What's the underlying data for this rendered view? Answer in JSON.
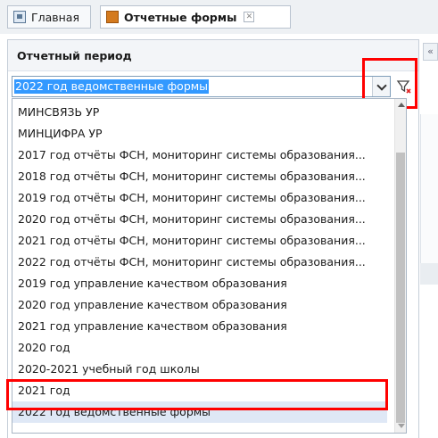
{
  "tabs": [
    {
      "label": "Главная",
      "icon": "home-icon"
    },
    {
      "label": "Отчетные формы",
      "icon": "form-icon",
      "close": "✕"
    }
  ],
  "panel": {
    "title": "Отчетный период",
    "collapse_label": "«"
  },
  "combo": {
    "value": "2022 год ведомственные формы"
  },
  "list": {
    "items": [
      "МИНСВЯЗЬ УР",
      "МИНЦИФРА УР",
      "2017 год отчёты ФСН, мониторинг системы образования...",
      "2018 год отчёты ФСН, мониторинг системы образования...",
      "2019 год отчёты ФСН, мониторинг системы образования...",
      "2020 год отчёты ФСН, мониторинг системы образования...",
      "2021 год отчёты ФСН, мониторинг системы образования...",
      "2022 год отчёты ФСН, мониторинг системы образования...",
      "2019 год управление качеством образования",
      "2020 год управление качеством образования",
      "2021 год управление качеством образования",
      "2020 год",
      "2020-2021 учебный год школы",
      "2021 год",
      "2022 год ведомственные формы"
    ],
    "selected_index": 14
  },
  "colors": {
    "highlight": "#ff0000",
    "selection_bg": "#3399ff",
    "form_icon": "#d47a1e"
  }
}
